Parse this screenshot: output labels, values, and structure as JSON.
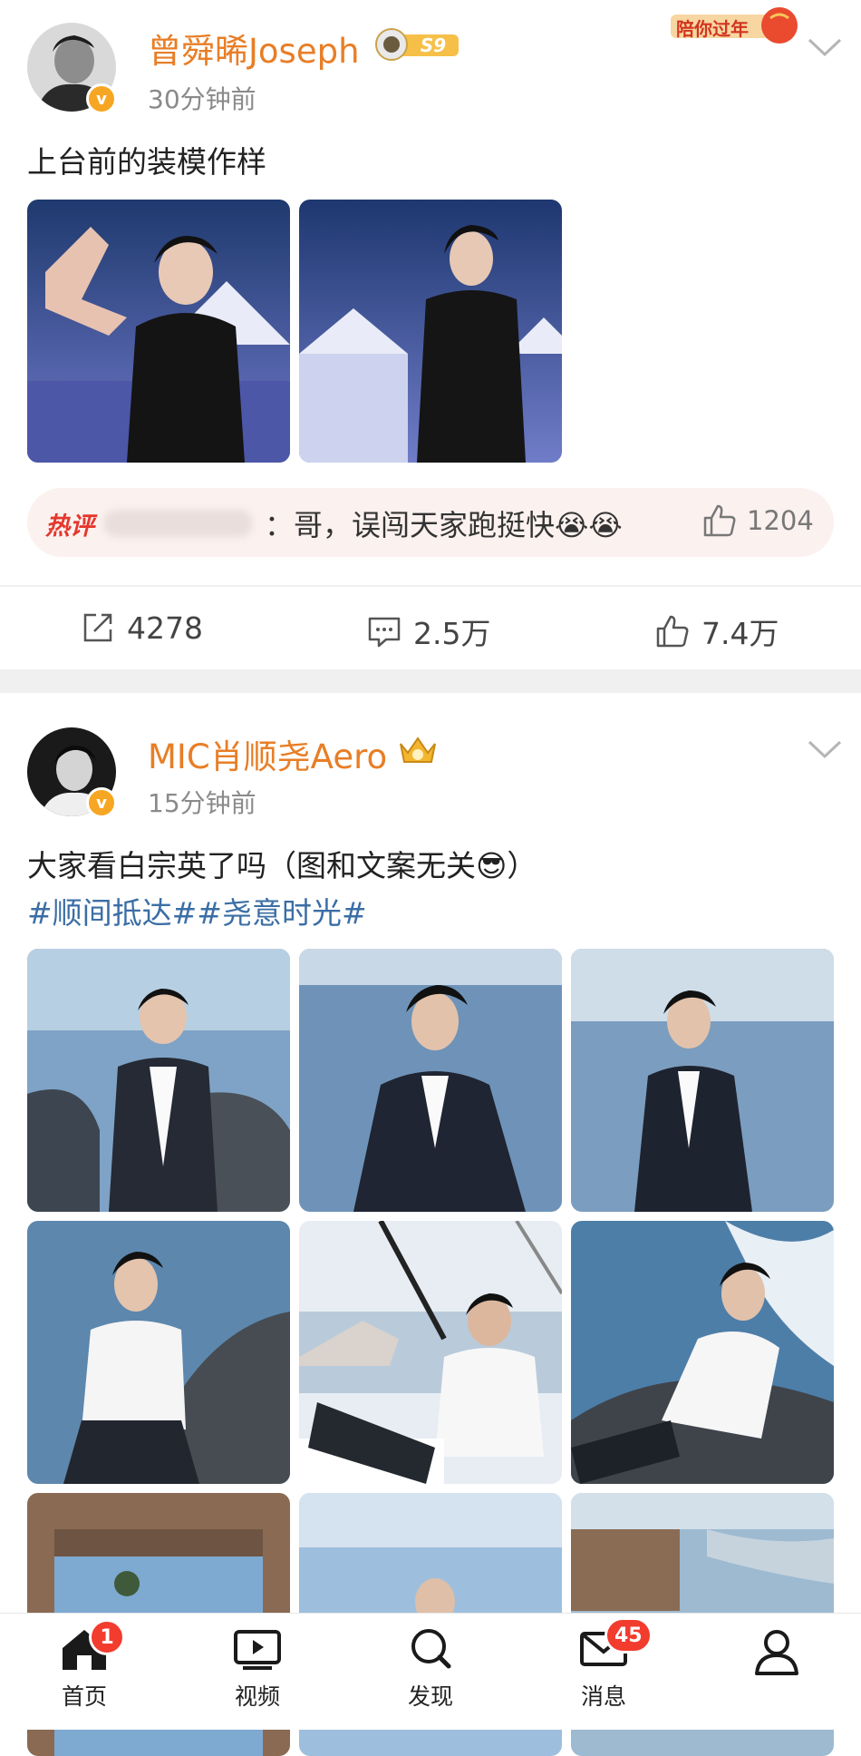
{
  "post1": {
    "username": "曾舜晞Joseph",
    "level_badge": "S9",
    "event_badge": "陪你过年",
    "time": "30分钟前",
    "text": "上台前的装模作样",
    "hot_comment": {
      "tag": "热评",
      "text": "：哥，误闯天家跑挺快😭😭",
      "likes": "1204"
    },
    "actions": {
      "reposts": "4278",
      "comments": "2.5万",
      "likes": "7.4万"
    }
  },
  "post2": {
    "username": "MIC肖顺尧Aero",
    "time": "15分钟前",
    "text": "大家看白宗英了吗（图和文案无关😎）",
    "hashtags": "#顺间抵达##尧意时光#"
  },
  "tabbar": {
    "home": {
      "label": "首页",
      "badge": "1"
    },
    "video": {
      "label": "视频"
    },
    "discover": {
      "label": "发现"
    },
    "messages": {
      "label": "消息",
      "badge": "45"
    },
    "profile": {
      "label": ""
    }
  },
  "icons": {
    "verified": "verified-badge-icon",
    "chevron": "chevron-down-icon",
    "repost": "repost-icon",
    "comment": "comment-icon",
    "like": "thumbs-up-icon"
  },
  "colors": {
    "username": "#e87e26",
    "hashtag": "#3b6ea5",
    "hot": "#e5372d",
    "badge": "#f23c2e",
    "verified": "#f6a623"
  }
}
